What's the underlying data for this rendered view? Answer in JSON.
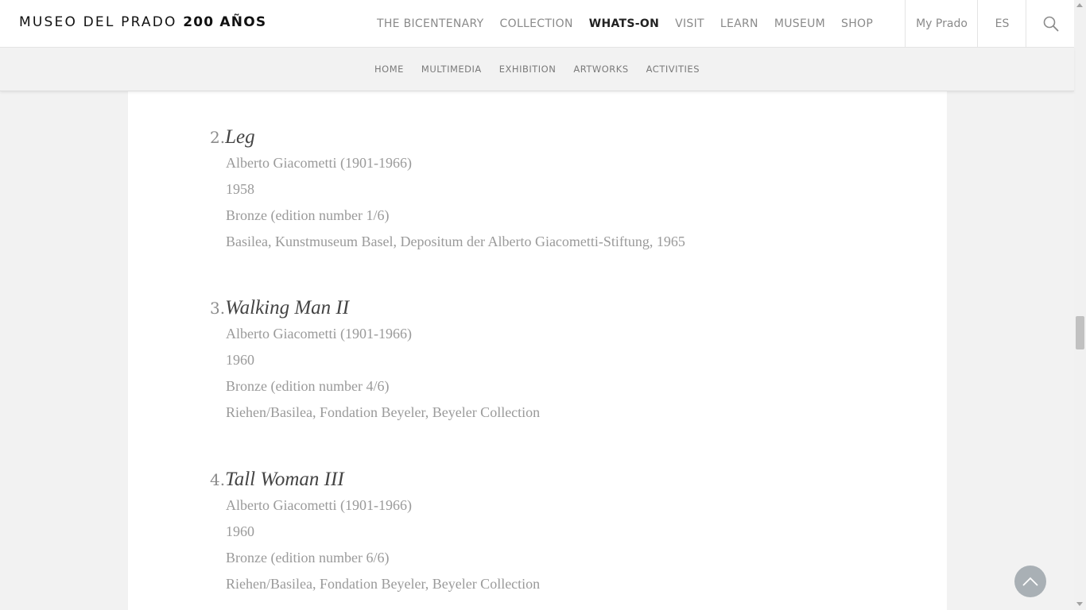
{
  "header": {
    "logo_text": "MUSEO DEL PRADO",
    "logo_bold": "200 AÑOS",
    "nav": [
      {
        "label": "THE BICENTENARY"
      },
      {
        "label": "COLLECTION"
      },
      {
        "label": "WHATS-ON"
      },
      {
        "label": "VISIT"
      },
      {
        "label": "LEARN"
      },
      {
        "label": "MUSEUM"
      },
      {
        "label": "SHOP"
      }
    ],
    "active_nav": "WHATS-ON",
    "my_prado": "My Prado",
    "language": "ES",
    "search_icon": "search-icon"
  },
  "subnav": {
    "items": [
      {
        "label": "HOME"
      },
      {
        "label": "MULTIMEDIA"
      },
      {
        "label": "EXHIBITION"
      },
      {
        "label": "ARTWORKS"
      },
      {
        "label": "ACTIVITIES"
      }
    ]
  },
  "artworks": [
    {
      "number": "2.",
      "title": "Leg",
      "artist": "Alberto Giacometti (1901-1966)",
      "date": "1958",
      "medium": "Bronze (edition number 1/6)",
      "collection": "Basilea, Kunstmuseum Basel, Depositum der Alberto Giacometti-Stiftung, 1965"
    },
    {
      "number": "3.",
      "title": "Walking Man II",
      "artist": "Alberto Giacometti (1901-1966)",
      "date": "1960",
      "medium": "Bronze (edition number 4/6)",
      "collection": "Riehen/Basilea, Fondation Beyeler, Beyeler Collection"
    },
    {
      "number": "4.",
      "title": "Tall Woman III",
      "artist": "Alberto Giacometti (1901-1966)",
      "date": "1960",
      "medium": "Bronze (edition number 6/6)",
      "collection": "Riehen/Basilea, Fondation Beyeler, Beyeler Collection"
    }
  ],
  "back_to_top_icon": "chevron-up-icon"
}
